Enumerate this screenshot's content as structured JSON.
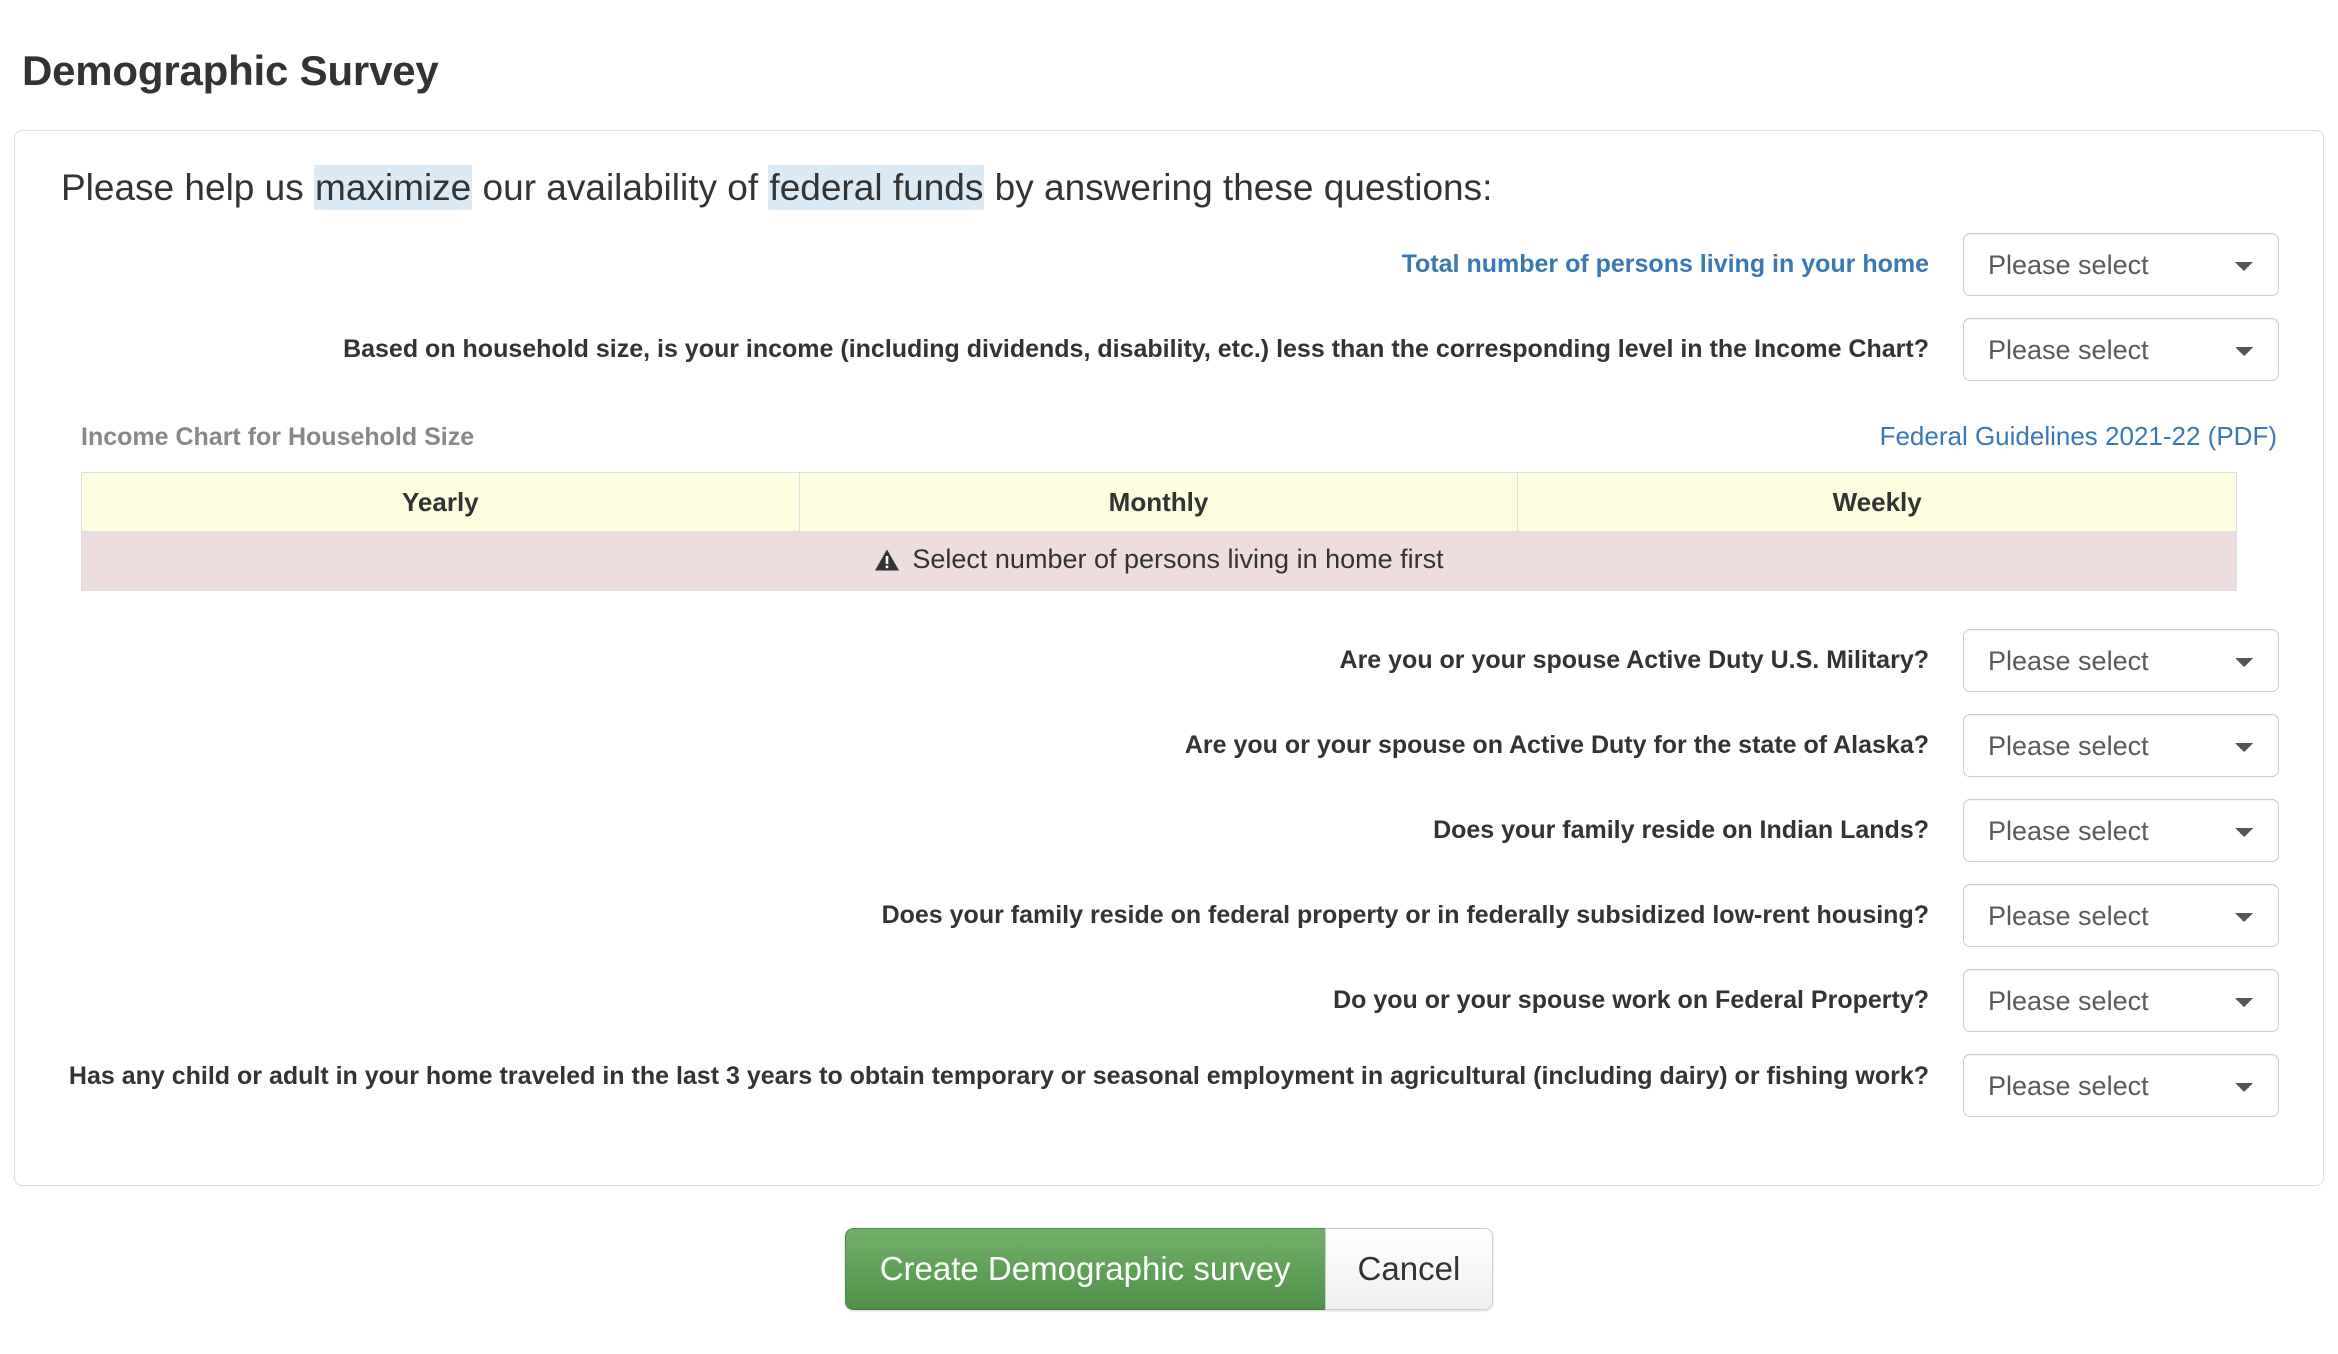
{
  "page": {
    "title": "Demographic Survey"
  },
  "intro": {
    "before_first": "Please help us ",
    "highlight_1": "maximize",
    "middle": " our availability of ",
    "highlight_2": "federal funds",
    "after": " by answering these questions:"
  },
  "fields": [
    {
      "label": "Total number of persons living in your home",
      "style": "link",
      "value": "Please select",
      "options": [
        "Please select"
      ]
    },
    {
      "label": "Based on household size, is your income (including dividends, disability, etc.) less than the corresponding level in the Income Chart?",
      "style": "normal",
      "value": "Please select",
      "options": [
        "Please select"
      ]
    }
  ],
  "income_chart": {
    "caption": "Income Chart for Household Size",
    "link_label": "Federal Guidelines 2021-22 (PDF)",
    "columns": [
      "Yearly",
      "Monthly",
      "Weekly"
    ],
    "warning_icon": "warning-triangle-icon",
    "warning_text": "Select number of persons living in home first"
  },
  "questions": [
    {
      "label": "Are you or your spouse Active Duty U.S. Military?",
      "value": "Please select",
      "options": [
        "Please select"
      ]
    },
    {
      "label": "Are you or your spouse on Active Duty for the state of Alaska?",
      "value": "Please select",
      "options": [
        "Please select"
      ]
    },
    {
      "label": "Does your family reside on Indian Lands?",
      "value": "Please select",
      "options": [
        "Please select"
      ]
    },
    {
      "label": "Does your family reside on federal property or in federally subsidized low-rent housing?",
      "value": "Please select",
      "options": [
        "Please select"
      ]
    },
    {
      "label": "Do you or your spouse work on Federal Property?",
      "value": "Please select",
      "options": [
        "Please select"
      ]
    },
    {
      "label": "Has any child or adult in your home traveled in the last 3 years to obtain temporary or seasonal employment in agricultural (including dairy) or fishing work?",
      "value": "Please select",
      "options": [
        "Please select"
      ]
    }
  ],
  "actions": {
    "submit_label": "Create Demographic survey",
    "cancel_label": "Cancel"
  },
  "colors": {
    "accent_link": "#3a78b5",
    "highlight": "#dceaf5",
    "table_header_bg": "#fdfddf",
    "warning_bg": "#eeddde",
    "primary_button": "#62a35a"
  }
}
